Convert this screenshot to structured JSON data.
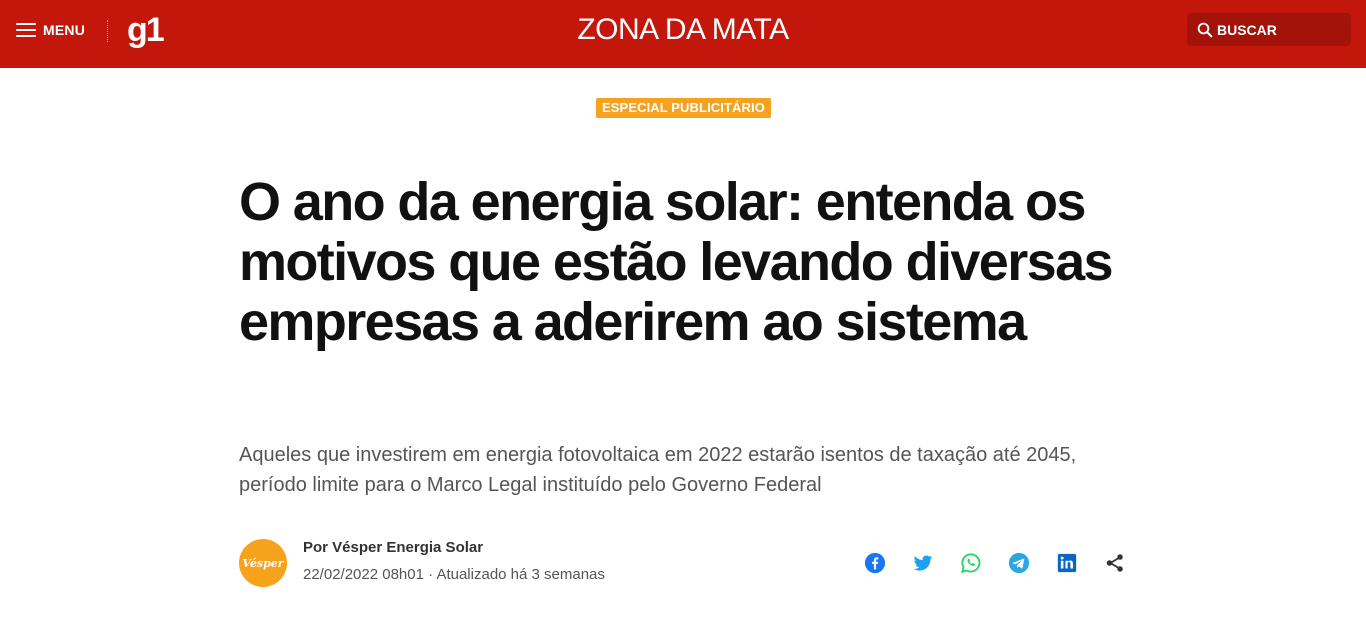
{
  "header": {
    "menu_label": "MENU",
    "logo": "g1",
    "region": "ZONA DA MATA",
    "search_label": "BUSCAR"
  },
  "article": {
    "tag": "ESPECIAL PUBLICITÁRIO",
    "title": "O ano da energia solar: entenda os motivos que estão levando diversas empresas a aderirem ao sistema",
    "subtitle": "Aqueles que investirem em energia fotovoltaica em 2022 estarão isentos de taxação até 2045, período limite para o Marco Legal instituído pelo Governo Federal",
    "author": "Por Vésper Energia Solar",
    "avatar_text": "Vésper",
    "date": "22/02/2022 08h01 · Atualizado há 3 semanas"
  },
  "share": [
    {
      "icon": "facebook-icon",
      "color": "#1877f2"
    },
    {
      "icon": "twitter-icon",
      "color": "#1da1f2"
    },
    {
      "icon": "whatsapp-icon",
      "color": "#25d366"
    },
    {
      "icon": "telegram-icon",
      "color": "#2ca5e0"
    },
    {
      "icon": "linkedin-icon",
      "color": "#0a66c2"
    },
    {
      "icon": "share-icon",
      "color": "#333333"
    }
  ],
  "colors": {
    "header_bg": "#c4170c",
    "tag_bg": "#f6a21e",
    "avatar_bg": "#f7a21b"
  }
}
